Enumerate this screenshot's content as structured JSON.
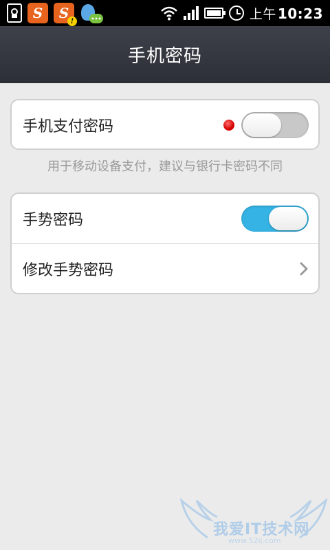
{
  "status_bar": {
    "ampm": "上午",
    "time": "10:23",
    "icons": [
      "doc-lock-icon",
      "sogou-icon",
      "sogou-warning-icon",
      "chat-icon",
      "wifi-icon",
      "signal-icon",
      "battery-icon",
      "alarm-icon"
    ]
  },
  "header": {
    "title": "手机密码"
  },
  "settings": {
    "payment_password": {
      "label": "手机支付密码",
      "enabled": false
    },
    "payment_hint": "用于移动设备支付，建议与银行卡密码不同",
    "gesture_password": {
      "label": "手势密码",
      "enabled": true
    },
    "change_gesture": {
      "label": "修改手势密码"
    }
  },
  "colors": {
    "toggle_on": "#35b3e4",
    "toggle_off": "#c8c8c8",
    "indicator": "#d40000",
    "title_bar": "#33363d"
  },
  "watermark": {
    "text": "我爱IT技术网",
    "url": "www.52ij.com"
  }
}
